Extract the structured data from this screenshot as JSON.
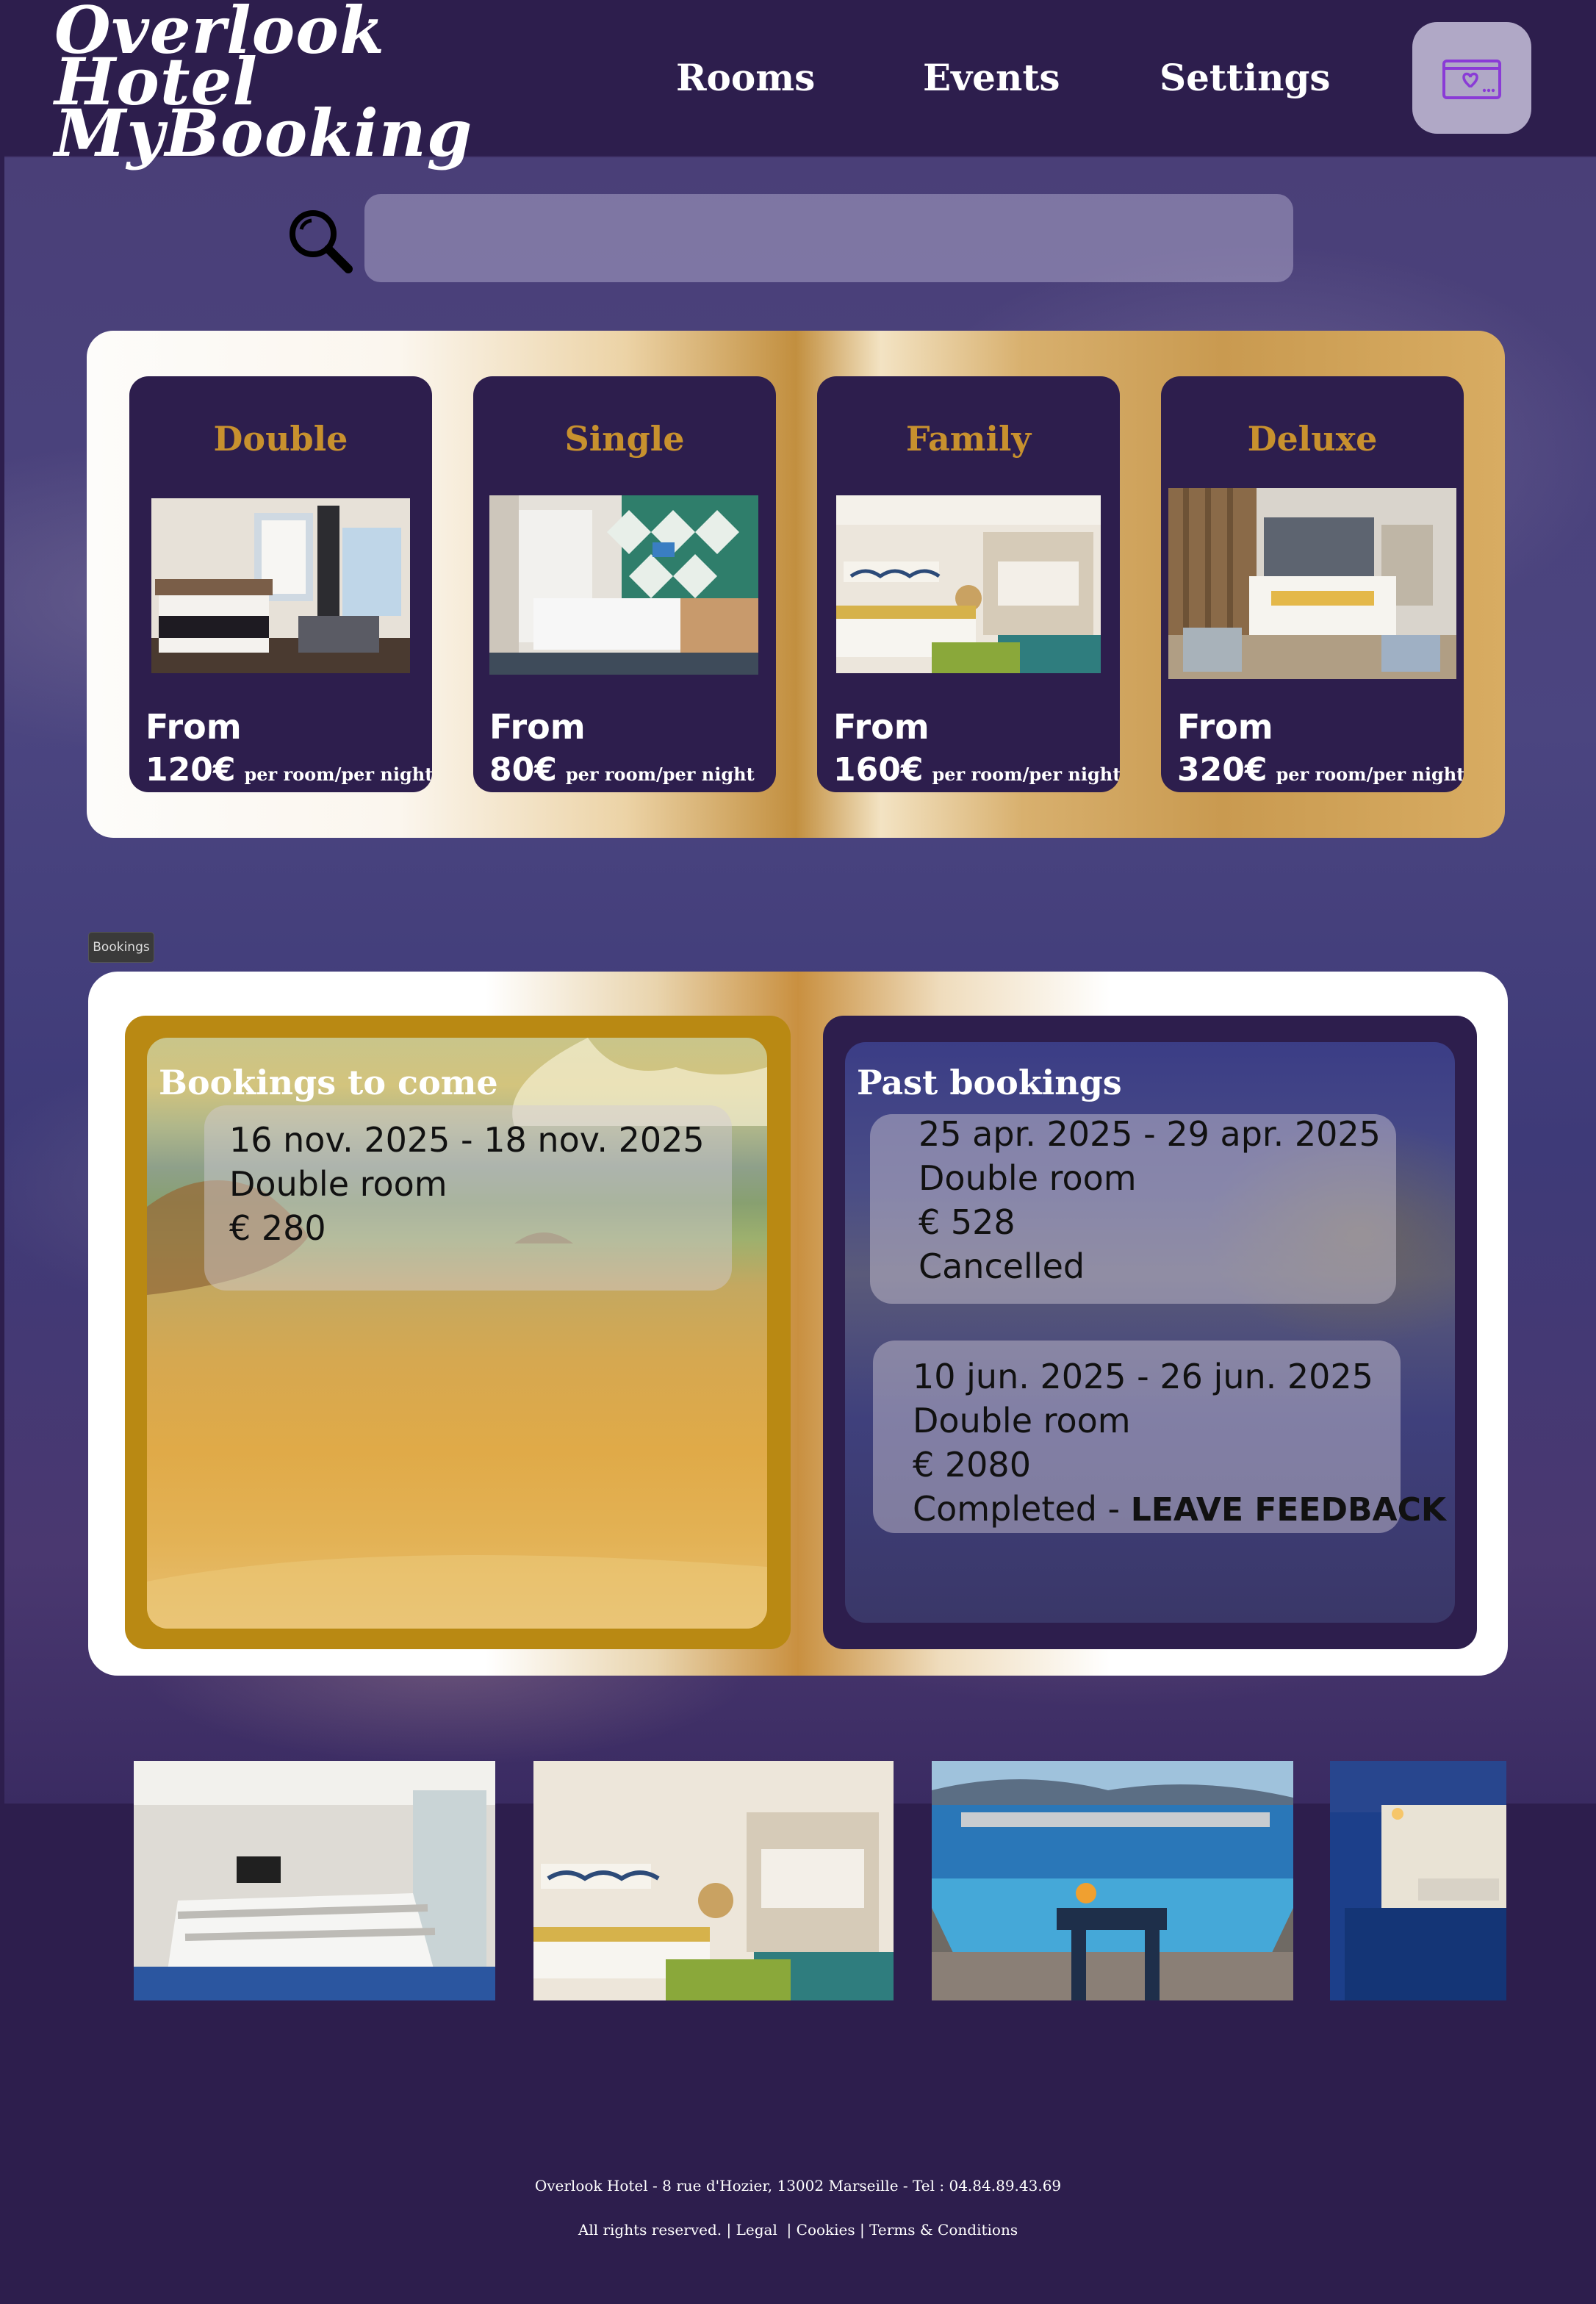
{
  "header": {
    "logo_line1": "Overlook Hotel",
    "logo_line2": "MyBooking",
    "nav": [
      "Rooms",
      "Events",
      "Settings"
    ],
    "cart_icon": "booking-card-icon"
  },
  "search": {
    "placeholder": "",
    "icon": "magnifier-icon"
  },
  "rooms": [
    {
      "title": "Double",
      "from_label": "From",
      "price": "120€",
      "unit": "per room/per night"
    },
    {
      "title": "Single",
      "from_label": "From",
      "price": "80€",
      "unit": "per room/per night"
    },
    {
      "title": "Family",
      "from_label": "From",
      "price": "160€",
      "unit": "per room/per night"
    },
    {
      "title": "Deluxe",
      "from_label": "From",
      "price": "320€",
      "unit": "per room/per night"
    }
  ],
  "tooltip": "Bookings",
  "bookings": {
    "upcoming_title": "Bookings to come",
    "upcoming": [
      {
        "dates": "16 nov. 2025 - 18 nov. 2025",
        "room": "Double room",
        "price": "€ 280"
      }
    ],
    "past_title": "Past bookings",
    "past": [
      {
        "dates": "25 apr. 2025 - 29 apr. 2025",
        "room": "Double room",
        "price": "€ 528",
        "status": "Cancelled",
        "action": ""
      },
      {
        "dates": "10 jun. 2025 - 26 jun. 2025",
        "room": "Double room",
        "price": "€ 2080",
        "status": "Completed - ",
        "action": "LEAVE FEEDBACK"
      }
    ]
  },
  "footer": {
    "address": "Overlook Hotel - 8 rue d'Hozier, 13002 Marseille - Tel : 04.84.89.43.69",
    "rights": "All rights reserved.",
    "links": [
      "Legal",
      "Cookies",
      "Terms & Conditions"
    ]
  },
  "colors": {
    "primary": "#2d1e4d",
    "gold": "#c8912e",
    "accent_purple": "#8a3bd6"
  }
}
